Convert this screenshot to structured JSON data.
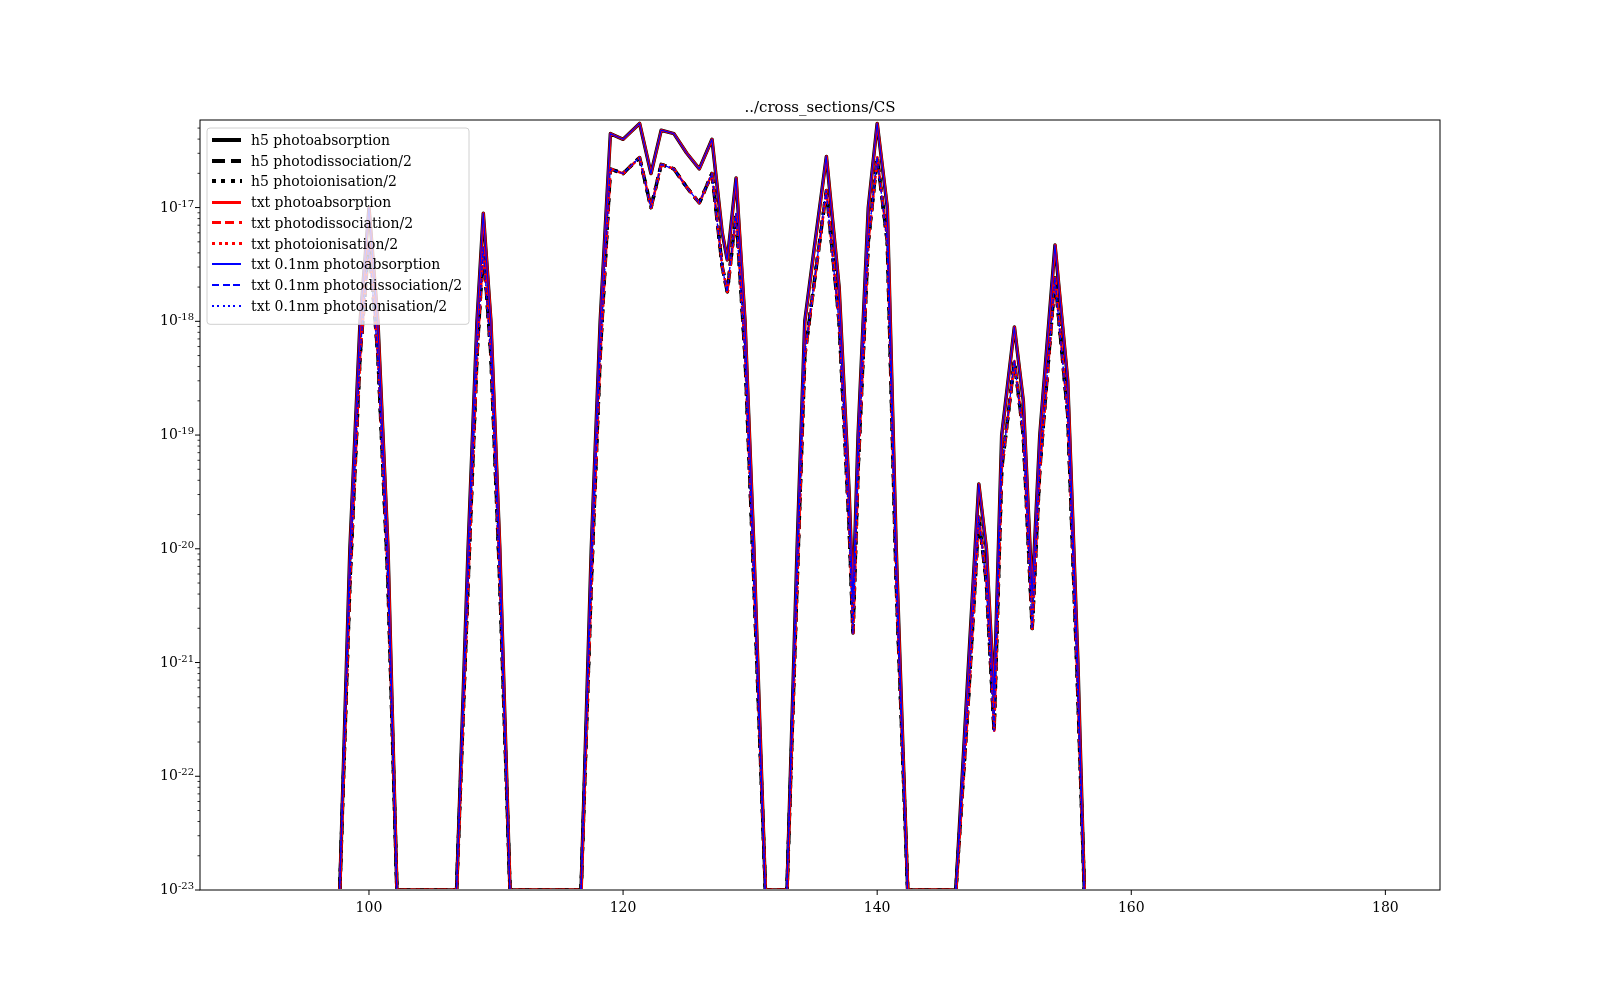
{
  "plot": {
    "title": "../cross_sections/CS",
    "legend": [
      {
        "label": "h5 photoabsorption",
        "color": "#000000"
      },
      {
        "label": "h5 photodissociation/2",
        "color": "#000000"
      },
      {
        "label": "h5 photoionisation/2",
        "color": "#000000"
      },
      {
        "label": "txt photoabsorption",
        "color": "#ff0000"
      },
      {
        "label": "txt photodissociation/2",
        "color": "#ff0000"
      },
      {
        "label": "txt photoionisation/2",
        "color": "#ff0000"
      },
      {
        "label": "txt 0.1nm photoabsorption",
        "color": "#0000ff"
      },
      {
        "label": "txt 0.1nm photodissociation/2",
        "color": "#0000ff"
      },
      {
        "label": "txt 0.1nm photoionisation/2",
        "color": "#0000ff"
      }
    ],
    "x_tick_labels": [
      "100",
      "120",
      "140",
      "160",
      "180"
    ],
    "y_tick_labels": [
      "10$^{-17}$",
      "10$^{-18}$",
      "10$^{-19}$",
      "10$^{-20}$",
      "10$^{-21}$",
      "10$^{-22}$",
      "10$^{-23}$"
    ]
  }
}
